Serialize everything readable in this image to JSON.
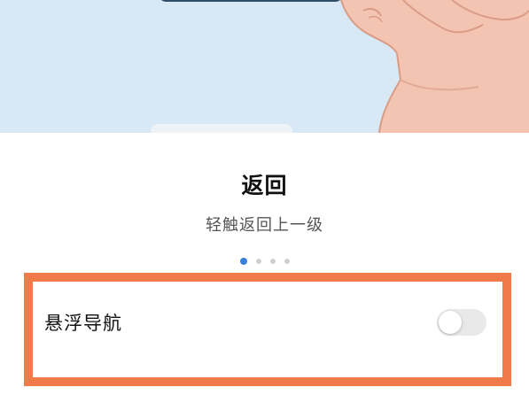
{
  "illustration": {
    "name": "back-gesture-illustration",
    "background_color": "#d9e8f5",
    "hand_color": "#f4c4b2"
  },
  "gesture": {
    "title": "返回",
    "description": "轻触返回上一级"
  },
  "pager": {
    "total": 4,
    "active_index": 0,
    "active_color": "#3a7fd9"
  },
  "floating_nav": {
    "label": "悬浮导航",
    "enabled": false
  },
  "highlight_color": "#f07a4a"
}
